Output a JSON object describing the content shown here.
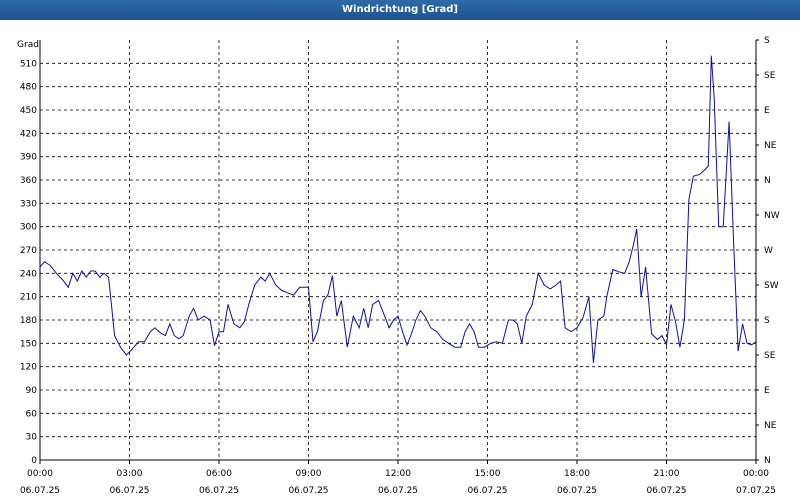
{
  "window": {
    "title": "Windrichtung [Grad]"
  },
  "chart_data": {
    "type": "line",
    "title": "Windrichtung [Grad]",
    "ylabel": "Grad",
    "ylim": [
      0,
      540
    ],
    "xlim": [
      "06.07.25 00:00",
      "07.07.25 00:00"
    ],
    "grid": true,
    "y_ticks": [
      0,
      30,
      60,
      90,
      120,
      150,
      180,
      210,
      240,
      270,
      300,
      330,
      360,
      390,
      420,
      450,
      480,
      510
    ],
    "right_ticks": [
      {
        "value": 0,
        "label": "N"
      },
      {
        "value": 45,
        "label": "NE"
      },
      {
        "value": 90,
        "label": "E"
      },
      {
        "value": 135,
        "label": "SE"
      },
      {
        "value": 180,
        "label": "S"
      },
      {
        "value": 225,
        "label": "SW"
      },
      {
        "value": 270,
        "label": "W"
      },
      {
        "value": 315,
        "label": "NW"
      },
      {
        "value": 360,
        "label": "N"
      },
      {
        "value": 405,
        "label": "NE"
      },
      {
        "value": 450,
        "label": "E"
      },
      {
        "value": 495,
        "label": "SE"
      },
      {
        "value": 540,
        "label": "S"
      }
    ],
    "x_ticks": [
      {
        "hour": 0,
        "time": "00:00",
        "date": "06.07.25"
      },
      {
        "hour": 3,
        "time": "03:00",
        "date": "06.07.25"
      },
      {
        "hour": 6,
        "time": "06:00",
        "date": "06.07.25"
      },
      {
        "hour": 9,
        "time": "09:00",
        "date": "06.07.25"
      },
      {
        "hour": 12,
        "time": "12:00",
        "date": "06.07.25"
      },
      {
        "hour": 15,
        "time": "15:00",
        "date": "06.07.25"
      },
      {
        "hour": 18,
        "time": "18:00",
        "date": "06.07.25"
      },
      {
        "hour": 21,
        "time": "21:00",
        "date": "06.07.25"
      },
      {
        "hour": 24,
        "time": "00:00",
        "date": "07.07.25"
      }
    ],
    "series": [
      {
        "color": "#1010a0",
        "points": [
          [
            0.0,
            248
          ],
          [
            0.15,
            255
          ],
          [
            0.35,
            250
          ],
          [
            0.55,
            240
          ],
          [
            0.75,
            232
          ],
          [
            0.95,
            222
          ],
          [
            1.1,
            240
          ],
          [
            1.25,
            230
          ],
          [
            1.4,
            243
          ],
          [
            1.55,
            235
          ],
          [
            1.7,
            243
          ],
          [
            1.85,
            243
          ],
          [
            2.0,
            235
          ],
          [
            2.15,
            240
          ],
          [
            2.3,
            235
          ],
          [
            2.5,
            160
          ],
          [
            2.7,
            145
          ],
          [
            2.9,
            135
          ],
          [
            3.1,
            143
          ],
          [
            3.3,
            152
          ],
          [
            3.5,
            152
          ],
          [
            3.7,
            165
          ],
          [
            3.85,
            170
          ],
          [
            4.05,
            163
          ],
          [
            4.2,
            160
          ],
          [
            4.35,
            175
          ],
          [
            4.5,
            160
          ],
          [
            4.65,
            156
          ],
          [
            4.8,
            160
          ],
          [
            5.0,
            185
          ],
          [
            5.15,
            195
          ],
          [
            5.3,
            180
          ],
          [
            5.5,
            185
          ],
          [
            5.7,
            180
          ],
          [
            5.85,
            147
          ],
          [
            6.0,
            165
          ],
          [
            6.15,
            165
          ],
          [
            6.3,
            200
          ],
          [
            6.5,
            175
          ],
          [
            6.7,
            170
          ],
          [
            6.85,
            178
          ],
          [
            7.0,
            200
          ],
          [
            7.2,
            225
          ],
          [
            7.4,
            235
          ],
          [
            7.55,
            230
          ],
          [
            7.7,
            240
          ],
          [
            7.9,
            225
          ],
          [
            8.1,
            218
          ],
          [
            8.3,
            215
          ],
          [
            8.5,
            212
          ],
          [
            8.7,
            222
          ],
          [
            8.9,
            222
          ],
          [
            9.0,
            222
          ],
          [
            9.15,
            152
          ],
          [
            9.3,
            165
          ],
          [
            9.5,
            205
          ],
          [
            9.65,
            212
          ],
          [
            9.8,
            237
          ],
          [
            9.95,
            185
          ],
          [
            10.1,
            205
          ],
          [
            10.3,
            145
          ],
          [
            10.5,
            185
          ],
          [
            10.7,
            170
          ],
          [
            10.85,
            195
          ],
          [
            11.0,
            170
          ],
          [
            11.15,
            200
          ],
          [
            11.35,
            205
          ],
          [
            11.55,
            185
          ],
          [
            11.7,
            170
          ],
          [
            11.85,
            180
          ],
          [
            12.0,
            185
          ],
          [
            12.15,
            165
          ],
          [
            12.3,
            148
          ],
          [
            12.45,
            162
          ],
          [
            12.6,
            180
          ],
          [
            12.75,
            192
          ],
          [
            12.9,
            185
          ],
          [
            13.1,
            170
          ],
          [
            13.3,
            165
          ],
          [
            13.5,
            155
          ],
          [
            13.7,
            150
          ],
          [
            13.9,
            145
          ],
          [
            14.1,
            145
          ],
          [
            14.25,
            165
          ],
          [
            14.4,
            175
          ],
          [
            14.55,
            165
          ],
          [
            14.7,
            145
          ],
          [
            14.9,
            145
          ],
          [
            15.1,
            150
          ],
          [
            15.3,
            152
          ],
          [
            15.5,
            150
          ],
          [
            15.7,
            180
          ],
          [
            15.85,
            180
          ],
          [
            16.0,
            175
          ],
          [
            16.15,
            150
          ],
          [
            16.3,
            185
          ],
          [
            16.5,
            200
          ],
          [
            16.7,
            240
          ],
          [
            16.9,
            225
          ],
          [
            17.1,
            220
          ],
          [
            17.3,
            225
          ],
          [
            17.45,
            230
          ],
          [
            17.6,
            170
          ],
          [
            17.8,
            165
          ],
          [
            18.0,
            170
          ],
          [
            18.2,
            183
          ],
          [
            18.4,
            210
          ],
          [
            18.55,
            125
          ],
          [
            18.7,
            180
          ],
          [
            18.9,
            185
          ],
          [
            19.0,
            210
          ],
          [
            19.2,
            245
          ],
          [
            19.4,
            242
          ],
          [
            19.6,
            240
          ],
          [
            19.75,
            255
          ],
          [
            19.9,
            278
          ],
          [
            20.0,
            297
          ],
          [
            20.15,
            210
          ],
          [
            20.3,
            248
          ],
          [
            20.5,
            162
          ],
          [
            20.7,
            155
          ],
          [
            20.85,
            160
          ],
          [
            21.0,
            148
          ],
          [
            21.15,
            200
          ],
          [
            21.3,
            178
          ],
          [
            21.45,
            145
          ],
          [
            21.6,
            180
          ],
          [
            21.75,
            335
          ],
          [
            21.9,
            365
          ],
          [
            22.1,
            367
          ],
          [
            22.25,
            372
          ],
          [
            22.4,
            378
          ],
          [
            22.5,
            520
          ],
          [
            22.6,
            465
          ],
          [
            22.75,
            300
          ],
          [
            22.9,
            300
          ],
          [
            23.1,
            435
          ],
          [
            23.25,
            280
          ],
          [
            23.4,
            140
          ],
          [
            23.55,
            175
          ],
          [
            23.7,
            150
          ],
          [
            23.85,
            148
          ],
          [
            24.0,
            152
          ]
        ]
      }
    ]
  }
}
